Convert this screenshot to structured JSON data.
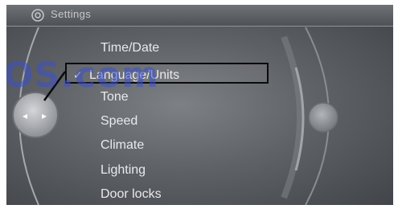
{
  "header": {
    "title": "Settings",
    "icon": "gear-icon"
  },
  "menu": {
    "items": [
      {
        "label": "Time/Date"
      },
      {
        "label": "Language/Units",
        "selected": true,
        "check": "✓"
      },
      {
        "label": "Tone"
      },
      {
        "label": "Speed"
      },
      {
        "label": "Climate"
      },
      {
        "label": "Lighting"
      },
      {
        "label": "Door locks"
      }
    ]
  },
  "controller": {
    "left_glyph": "◂",
    "right_glyph": "▸"
  },
  "watermark": {
    "text": "OS.com"
  },
  "colors": {
    "screen_bg": "#5f6267",
    "text": "#e9eaec",
    "selection_border": "#0b0b0c",
    "watermark": "#3c50c8"
  }
}
